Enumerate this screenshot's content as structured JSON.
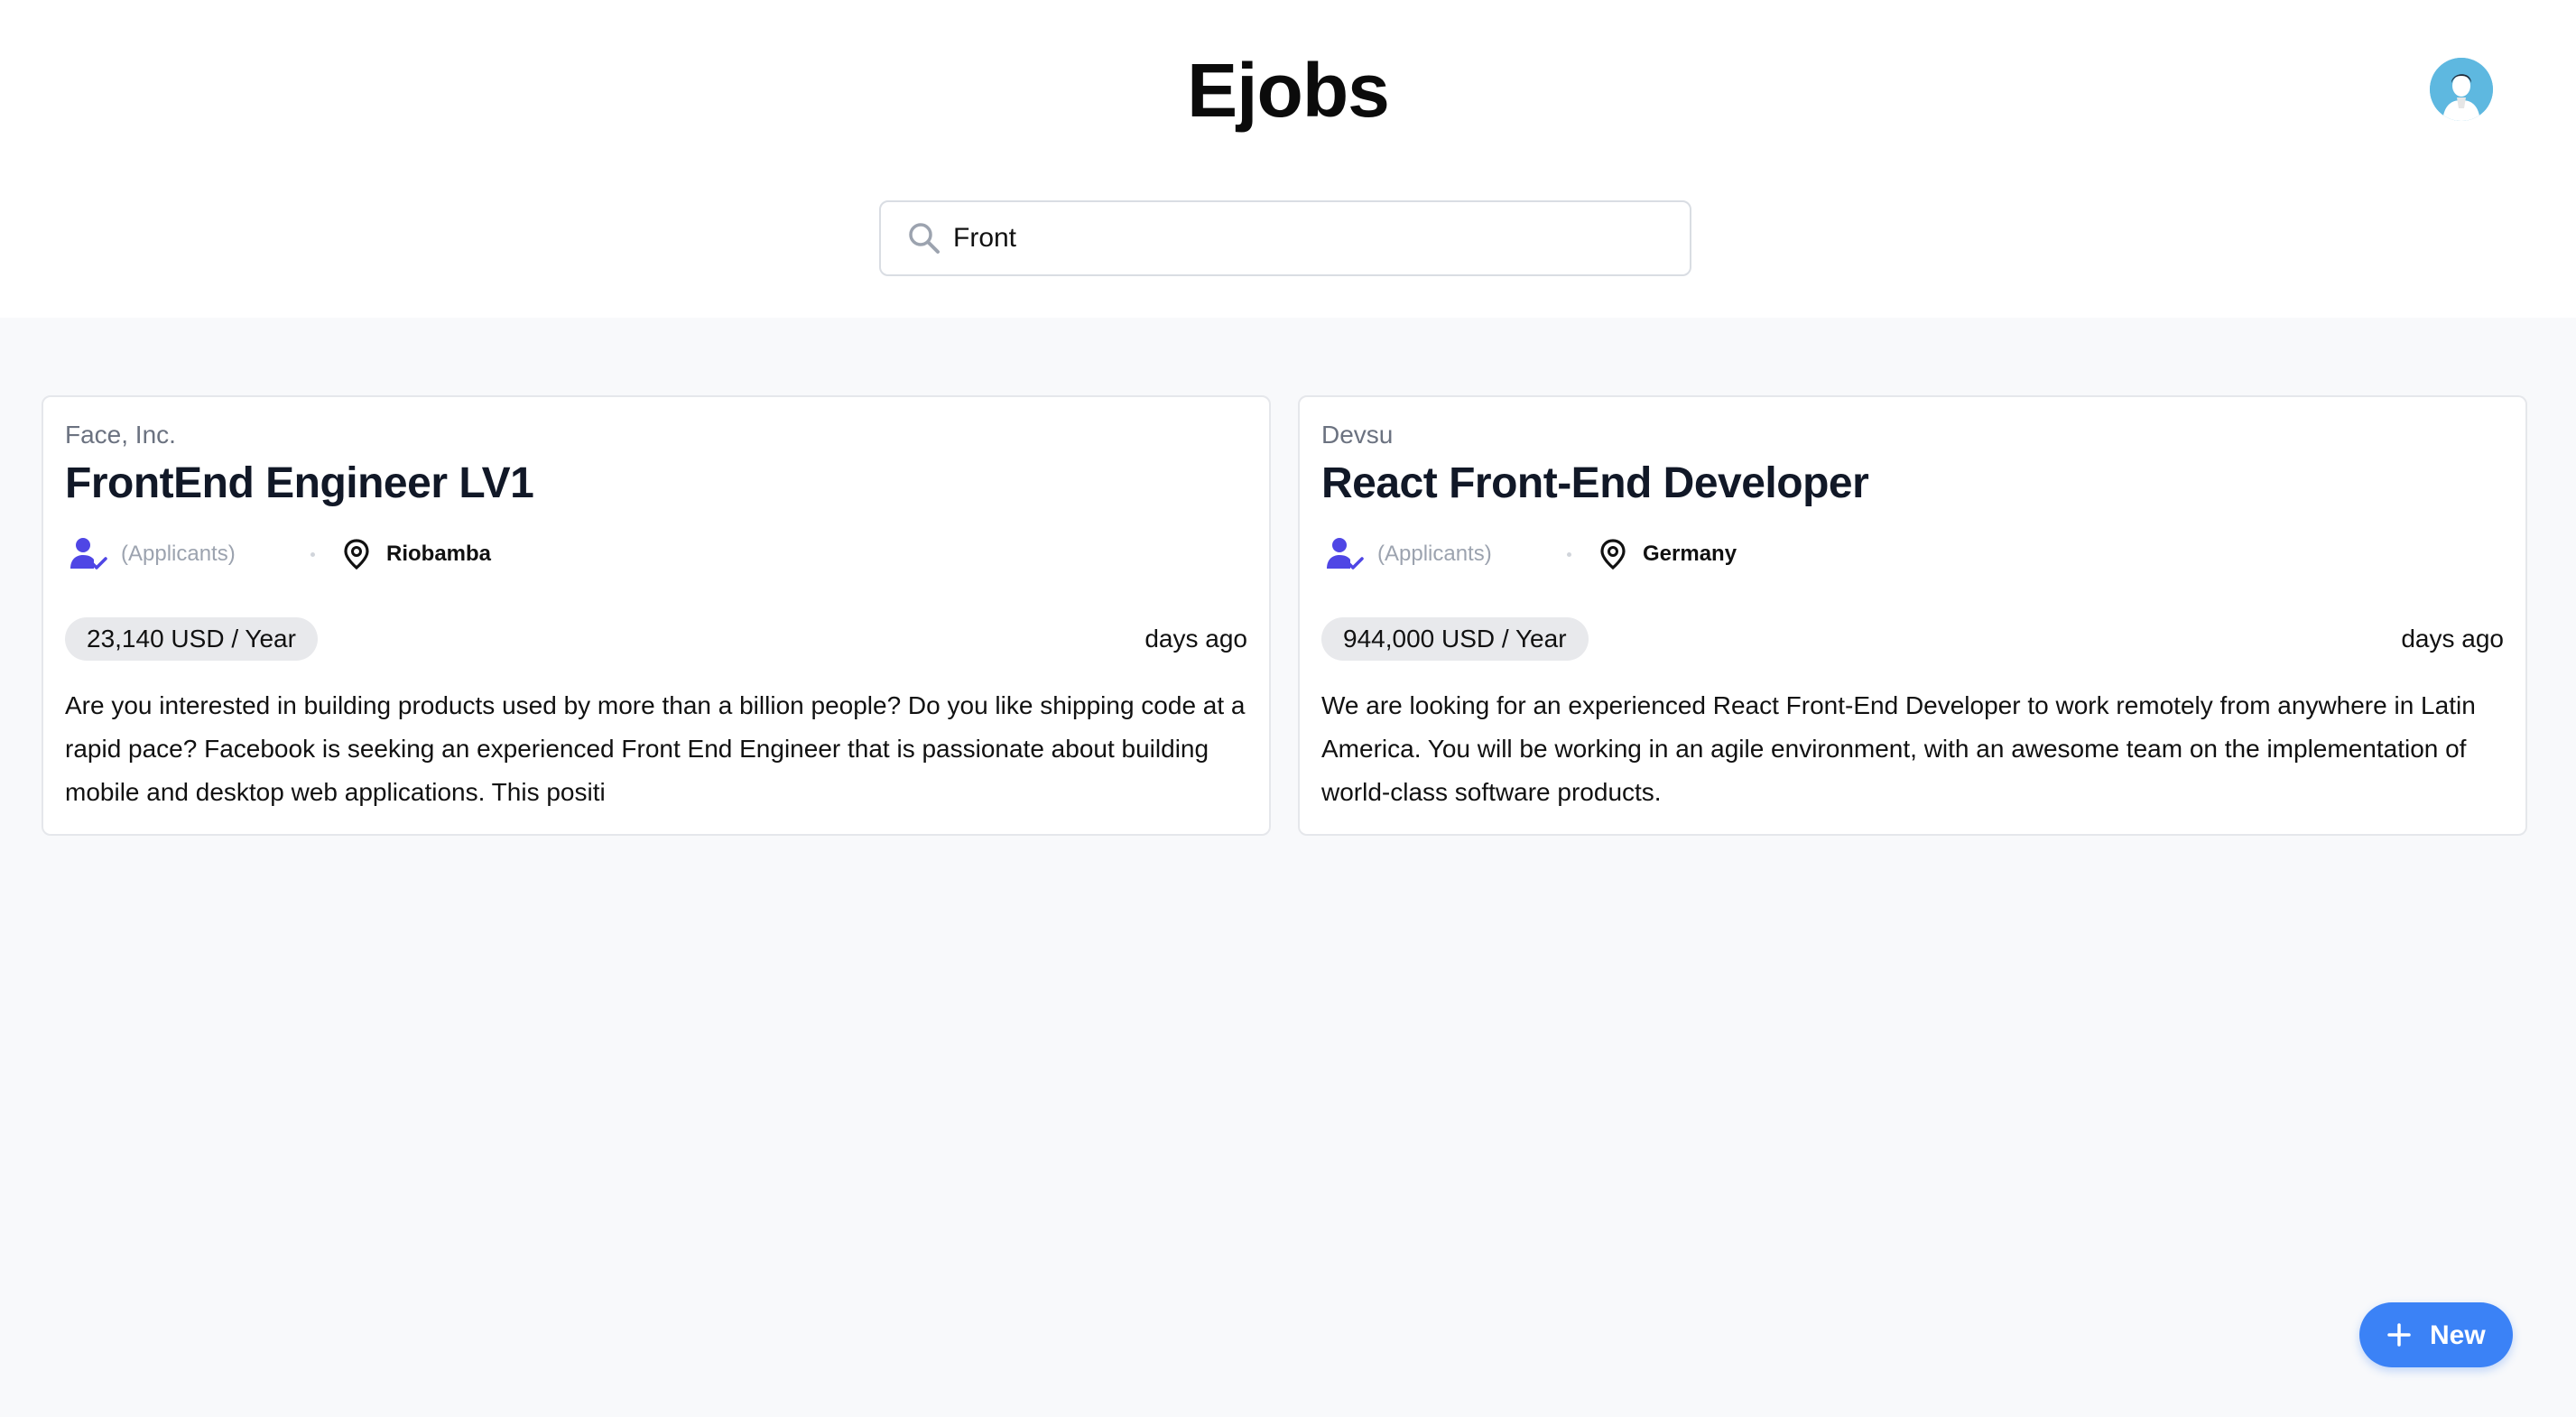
{
  "app": {
    "title": "Ejobs"
  },
  "search": {
    "value": "Front",
    "icon": "search-icon"
  },
  "jobs": [
    {
      "company": "Face, Inc.",
      "title": "FrontEnd Engineer LV1",
      "applicants": "(Applicants)",
      "location": "Riobamba",
      "salary": "23,140 USD / Year",
      "posted": "days ago",
      "description": "Are you interested in building products used by more than a billion people? Do you like shipping code at a rapid pace? Facebook is seeking an experienced Front End Engineer that is passionate about building mobile and desktop web applications. This positi"
    },
    {
      "company": "Devsu",
      "title": "React Front-End Developer",
      "applicants": "(Applicants)",
      "location": "Germany",
      "salary": "944,000 USD / Year",
      "posted": "days ago",
      "description": "We are looking for an experienced React Front-End Developer to work remotely from anywhere in Latin America. You will be working in an agile environment, with an awesome team on the implementation of world-class software products."
    }
  ],
  "fab": {
    "label": "New",
    "icon": "plus-icon"
  },
  "colors": {
    "accent": "#3b82f6",
    "applicant_icon": "#4f46e5",
    "avatar_bg": "#5eb8e0"
  }
}
